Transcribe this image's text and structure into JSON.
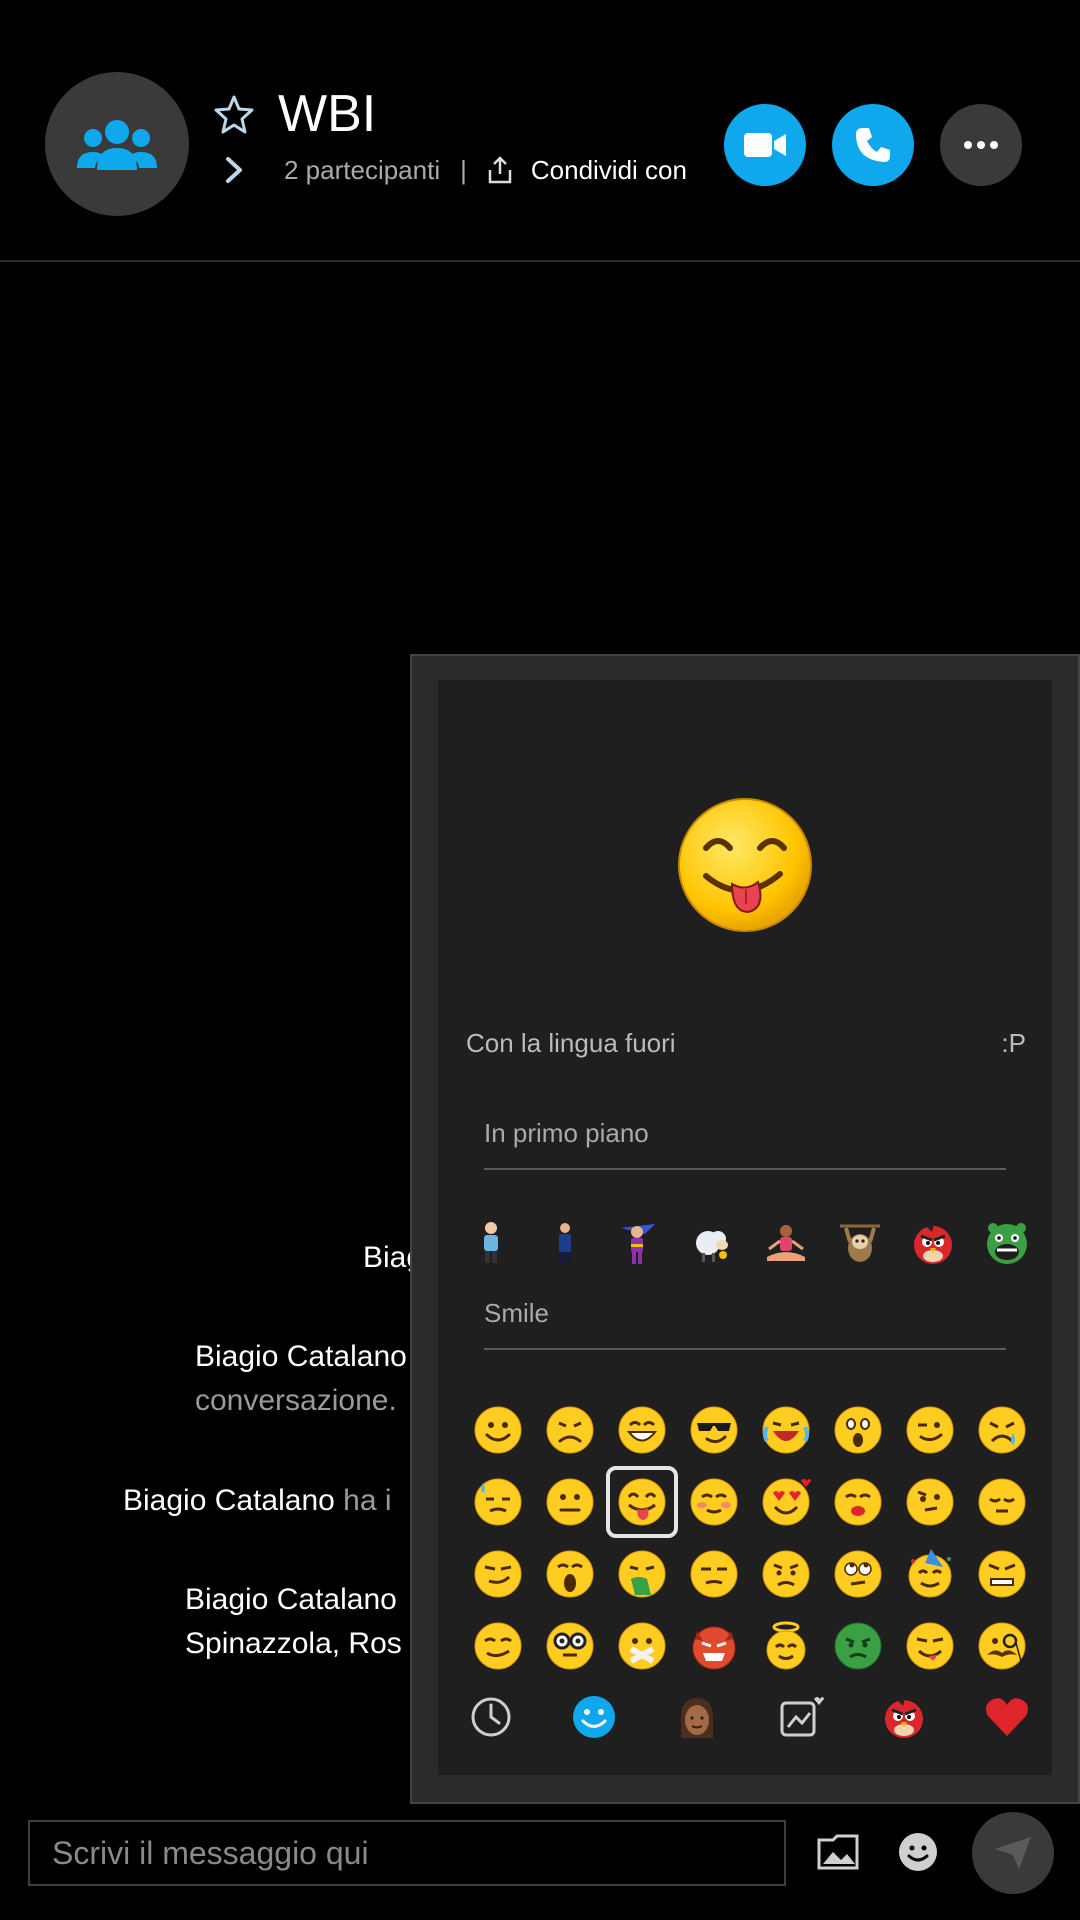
{
  "header": {
    "title": "WBI",
    "participants": "2 partecipanti",
    "separator": "|",
    "share_label": "Condividi con"
  },
  "messages": [
    {
      "line1": "Biag"
    },
    {
      "line1": "Biagio Catalano",
      "line2": "conversazione."
    },
    {
      "name": "Biagio Catalano",
      "rest": " ha i"
    },
    {
      "line1": "Biagio Catalano",
      "line2": "Spinazzola, Ros"
    }
  ],
  "emoji_panel": {
    "preview_name": "Con la lingua fuori",
    "preview_code": ":P",
    "section_featured": "In primo piano",
    "section_smile": "Smile",
    "featured_icons": [
      "person-figure-icon",
      "businessman-figure-icon",
      "superhero-icon",
      "sheep-icon",
      "yoga-woman-icon",
      "sloth-icon",
      "angry-bird-red-icon",
      "green-pig-icon"
    ],
    "categories": [
      "recent-clock-icon",
      "smiley-category-icon",
      "people-category-icon",
      "stickers-category-icon",
      "angry-birds-category-icon",
      "heart-category-icon"
    ],
    "selected_index": 10
  },
  "composer": {
    "placeholder": "Scrivi il messaggio qui"
  },
  "colors": {
    "accent": "#10a8ed",
    "background": "#000000",
    "panel": "#1f1f1f",
    "heart": "#e0242c"
  }
}
